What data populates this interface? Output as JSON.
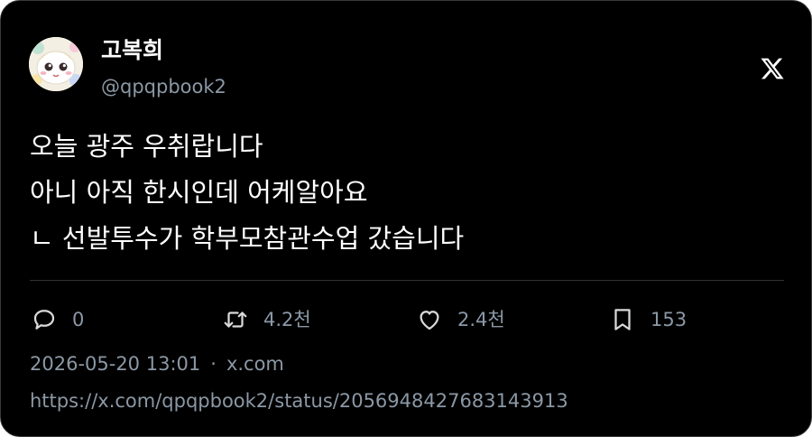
{
  "author": {
    "display_name": "고복희",
    "handle": "@qpqpbook2"
  },
  "logo_icon": "x-logo-icon",
  "tweet": {
    "lines": [
      "오늘 광주 우취랍니다",
      "아니 아직 한시인데 어케알아요",
      "ㄴ 선발투수가 학부모참관수업 갔습니다"
    ]
  },
  "actions": {
    "reply": {
      "icon": "reply-icon",
      "count": "0"
    },
    "retweet": {
      "icon": "retweet-icon",
      "count": "4.2천"
    },
    "like": {
      "icon": "heart-icon",
      "count": "2.4천"
    },
    "bookmark": {
      "icon": "bookmark-icon",
      "count": "153"
    }
  },
  "meta": {
    "timestamp": "2026-05-20 13:01",
    "separator": "·",
    "source": "x.com"
  },
  "status_url": "https://x.com/qpqpbook2/status/2056948427683143913",
  "colors": {
    "background": "#000000",
    "text_primary": "#ffffff",
    "text_secondary": "#8b98a5",
    "divider": "#2f3336",
    "border": "#3a3a3a"
  }
}
